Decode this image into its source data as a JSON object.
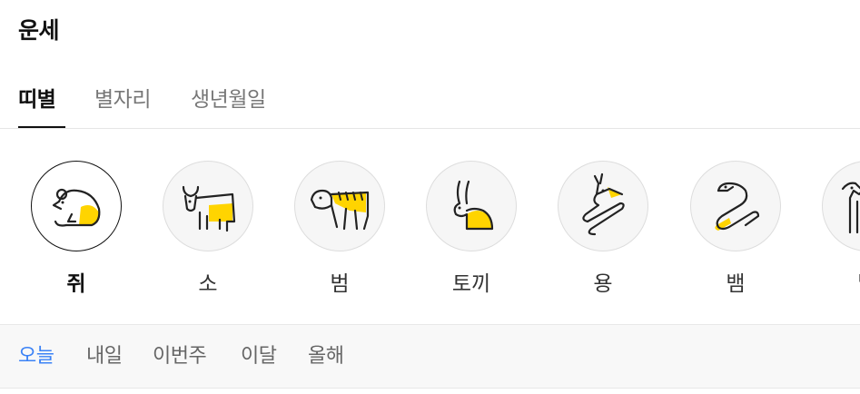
{
  "page": {
    "title": "운세"
  },
  "tabs": [
    {
      "label": "띠별",
      "active": true
    },
    {
      "label": "별자리",
      "active": false
    },
    {
      "label": "생년월일",
      "active": false
    }
  ],
  "zodiac": {
    "selected": "쥐",
    "items": [
      {
        "label": "쥐",
        "icon": "rat-icon"
      },
      {
        "label": "소",
        "icon": "ox-icon"
      },
      {
        "label": "범",
        "icon": "tiger-icon"
      },
      {
        "label": "토끼",
        "icon": "rabbit-icon"
      },
      {
        "label": "용",
        "icon": "dragon-icon"
      },
      {
        "label": "뱀",
        "icon": "snake-icon"
      },
      {
        "label": "말",
        "icon": "horse-icon"
      }
    ]
  },
  "period_tabs": [
    {
      "label": "오늘",
      "active": true
    },
    {
      "label": "내일",
      "active": false
    },
    {
      "label": "이번주",
      "active": false
    },
    {
      "label": "이달",
      "active": false
    },
    {
      "label": "올해",
      "active": false
    }
  ],
  "colors": {
    "accent_yellow": "#ffd400",
    "active_blue": "#3b82f6",
    "line_dark": "#222222"
  }
}
